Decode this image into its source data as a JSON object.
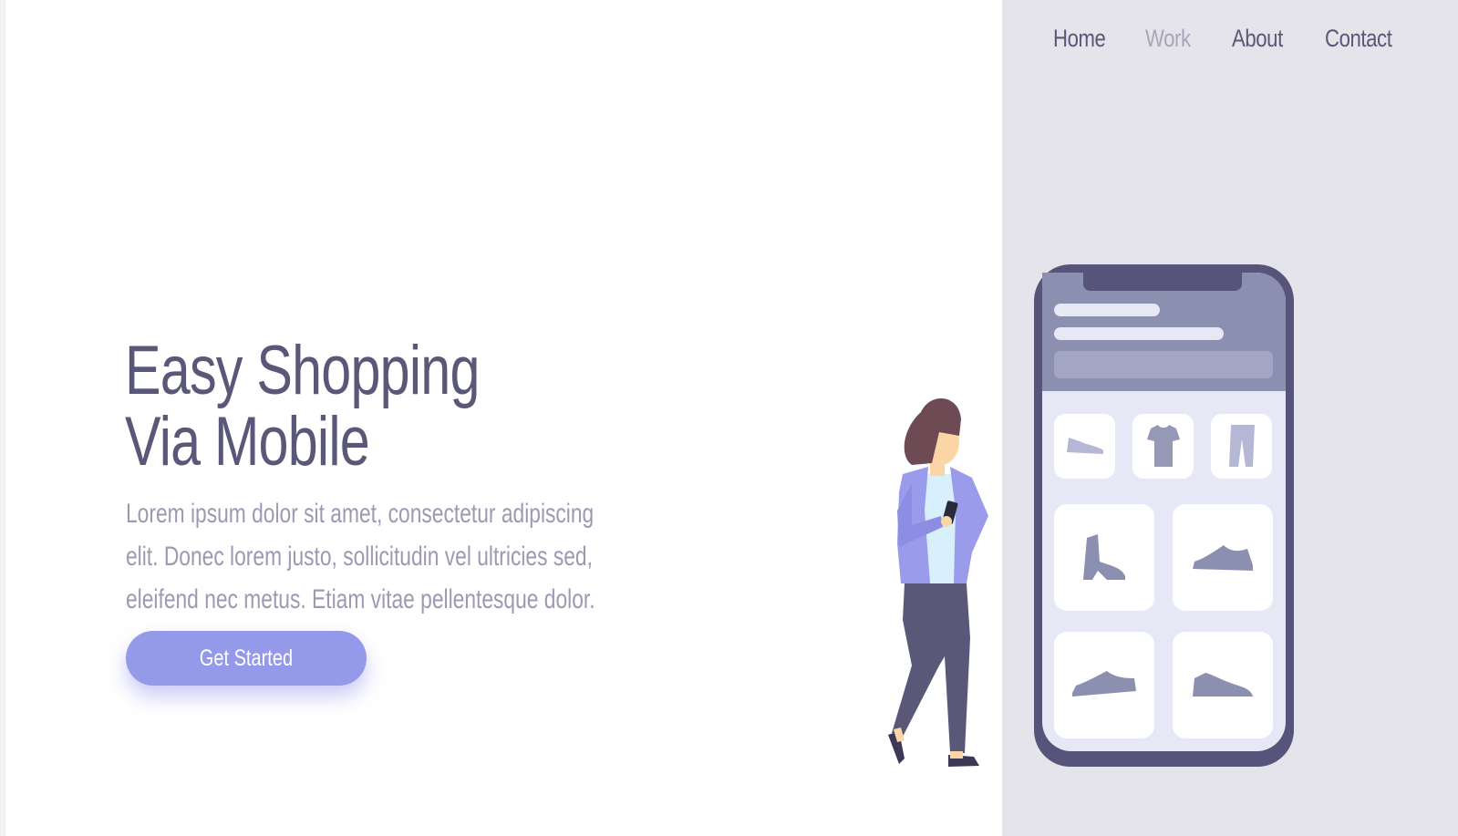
{
  "nav": {
    "items": [
      {
        "label": "Home",
        "active": false
      },
      {
        "label": "Work",
        "active": true
      },
      {
        "label": "About",
        "active": false
      },
      {
        "label": "Contact",
        "active": false
      }
    ]
  },
  "hero": {
    "title_line1": "Easy Shopping",
    "title_line2": "Via Mobile",
    "description": "Lorem ipsum dolor sit amet, consectetur adipiscing elit. Donec lorem justo, sollicitudin vel ultricies sed, eleifend nec metus. Etiam vitae pellentesque dolor.",
    "cta_label": "Get Started"
  },
  "illustration": {
    "phone_categories": [
      "shoe-icon",
      "tshirt-icon",
      "pants-icon"
    ],
    "phone_products": [
      "boot-icon",
      "sneaker-icon",
      "sneaker-icon",
      "sneaker-icon"
    ]
  },
  "colors": {
    "text_dark": "#5a5878",
    "text_muted": "#9c9ab2",
    "nav_active": "#a7a6ba",
    "accent": "#9599e9",
    "panel_bg": "#e4e4ea",
    "phone_frame": "#56547a"
  }
}
